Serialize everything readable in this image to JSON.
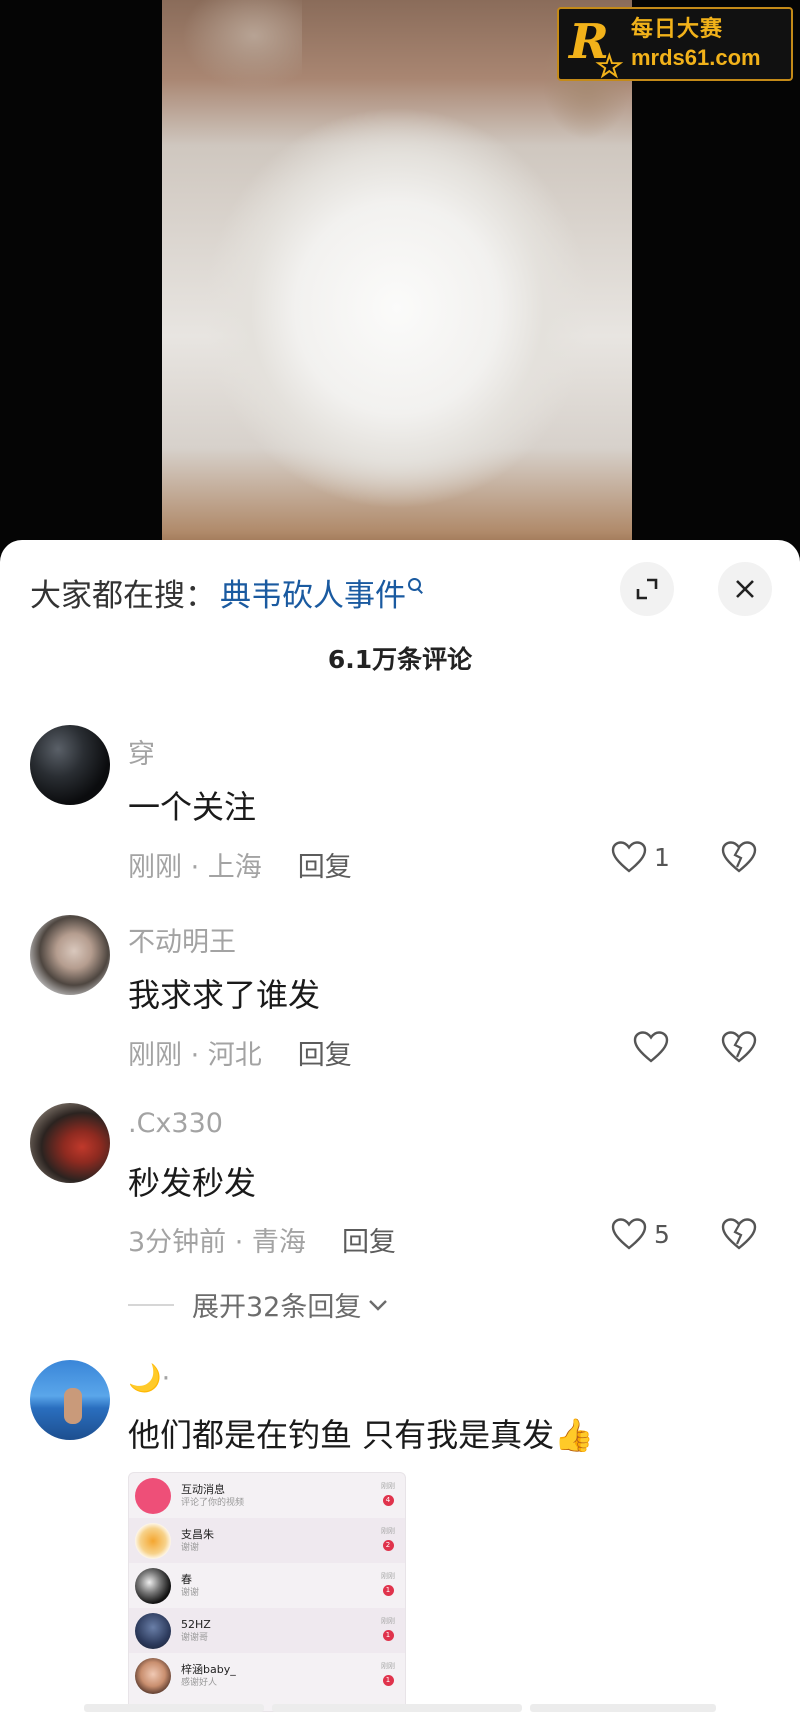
{
  "watermark": {
    "logo_letter": "R",
    "title": "每日大赛",
    "url": "mrds61.com"
  },
  "sheet": {
    "search_prefix": "大家都在搜：",
    "search_keyword": "典韦砍人事件",
    "comment_count": "6.1万条评论"
  },
  "comments": [
    {
      "username": "穿",
      "content": "一个关注",
      "time": "刚刚 · 上海",
      "reply_label": "回复",
      "likes": "1"
    },
    {
      "username": "不动明王",
      "content": "我求求了谁发",
      "time": "刚刚 · 河北",
      "reply_label": "回复",
      "likes": ""
    },
    {
      "username": ".Cx330",
      "content": "秒发秒发",
      "time": "3分钟前 · 青海",
      "reply_label": "回复",
      "likes": "5",
      "expand_label": "展开32条回复"
    },
    {
      "username": "🌙·",
      "content": "他们都是在钓鱼 只有我是真发👍"
    }
  ],
  "comment_image": {
    "rows": [
      {
        "name": "互动消息",
        "sub": "评论了你的视频",
        "time": "刚刚",
        "badge": "4"
      },
      {
        "name": "支昌朱",
        "sub": "谢谢",
        "time": "刚刚",
        "badge": "2"
      },
      {
        "name": "春",
        "sub": "谢谢",
        "time": "刚刚",
        "badge": "1"
      },
      {
        "name": "52HZ",
        "sub": "谢谢哥",
        "time": "刚刚",
        "badge": "1"
      },
      {
        "name": "梓涵baby_",
        "sub": "感谢好人",
        "time": "刚刚",
        "badge": "1"
      }
    ]
  },
  "colors": {
    "keyword": "#1a5aa0",
    "watermark_gold": "#f2b21a",
    "badge_red": "#e0334c"
  }
}
